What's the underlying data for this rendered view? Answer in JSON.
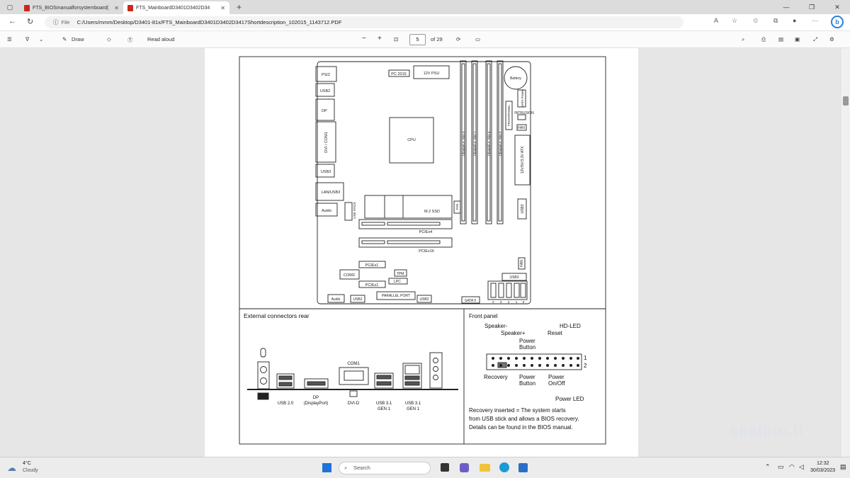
{
  "tabs": [
    {
      "title": "FTS_BIOSmanualforsystemboard(",
      "active": false
    },
    {
      "title": "FTS_MainboardD3401D3402D34",
      "active": true
    }
  ],
  "new_tab_symbol": "+",
  "address": {
    "scheme": "File",
    "url": "C:/Users/mmm/Desktop/D3401-81x/FTS_MainboardD3401D3402D3417Shortdescription_102015_1143712.PDF"
  },
  "pdf_toolbar": {
    "draw_label": "Draw",
    "read_aloud_label": "Read aloud",
    "zoom_out": "−",
    "zoom_in": "+",
    "page_number": "5",
    "page_count": "of 29"
  },
  "board": {
    "left_ports": [
      "PS/2",
      "USB2",
      "DP",
      "DVI / COM1",
      "USB3",
      "LAN/USB3",
      "Audio"
    ],
    "top": {
      "pc2015": "PC 2015",
      "psu": "12V PSU",
      "battery": "Battery",
      "cpu": "CPU"
    },
    "dimm_slots": [
      "Channel A, Slot 3",
      "Channel A, Slot 1",
      "Channel A, Slot 4",
      "Channel A, Slot 2"
    ],
    "right": {
      "sata_power": "SATA Power",
      "front_panel": "FRONTPANEL",
      "intrusion": "INTRUSION",
      "fan_top": "FAN",
      "atx": "12V/5V/3,3V ATX",
      "usb3_right": "USB3",
      "fan_bottom": "FAN",
      "usb3_sata": "USB3",
      "sata5": "SATA 5",
      "sata_nums": [
        "4",
        "3",
        "2",
        "1",
        "0"
      ]
    },
    "middle": {
      "m2": "M.2 SSD",
      "fan_m2": "FAN",
      "usb_stick": "USB STICK",
      "pciex4": "PCIEx4",
      "pciex16": "PCIEx16",
      "pciex1_a": "PCIEx1",
      "pciex1_b": "PCIEx1",
      "com2": "COM2",
      "tpm": "TPM",
      "lpc": "LPC"
    },
    "bottom": {
      "audio": "Audio",
      "usb2_a": "USB2",
      "parallel": "PARALLEL PORT",
      "usb2_b": "USB2"
    }
  },
  "rear": {
    "title": "External connectors rear",
    "com1": "COM1",
    "labels": [
      {
        "l1": "USB 2.0",
        "l2": ""
      },
      {
        "l1": "DP",
        "l2": "(DisplayPort)"
      },
      {
        "l1": "DVI-D",
        "l2": ""
      },
      {
        "l1": "USB 3.1",
        "l2": "GEN 1"
      },
      {
        "l1": "USB 3.1",
        "l2": "GEN 1"
      }
    ]
  },
  "front": {
    "title": "Front panel",
    "speaker_minus": "Speaker-",
    "speaker_plus": "Speaker+",
    "power_button_top": "Power\nButton",
    "reset": "Reset",
    "hd_led": "HD-LED",
    "row1": "1",
    "row2": "2",
    "recovery": "Recovery",
    "power_button_bottom": "Power\nButton",
    "power_onoff": "Power\nOn/Off",
    "power_led": "Power LED",
    "note": [
      "Recovery inserted = The system starts",
      "from USB stick and allows a BIOS recovery.",
      "Details can be found in the BIOS manual."
    ]
  },
  "watermark": "skelbiu.lt",
  "taskbar": {
    "weather_temp": "4°C",
    "weather_desc": "Cloudy",
    "search_placeholder": "Search",
    "time": "12:32",
    "date": "30/03/2023"
  }
}
